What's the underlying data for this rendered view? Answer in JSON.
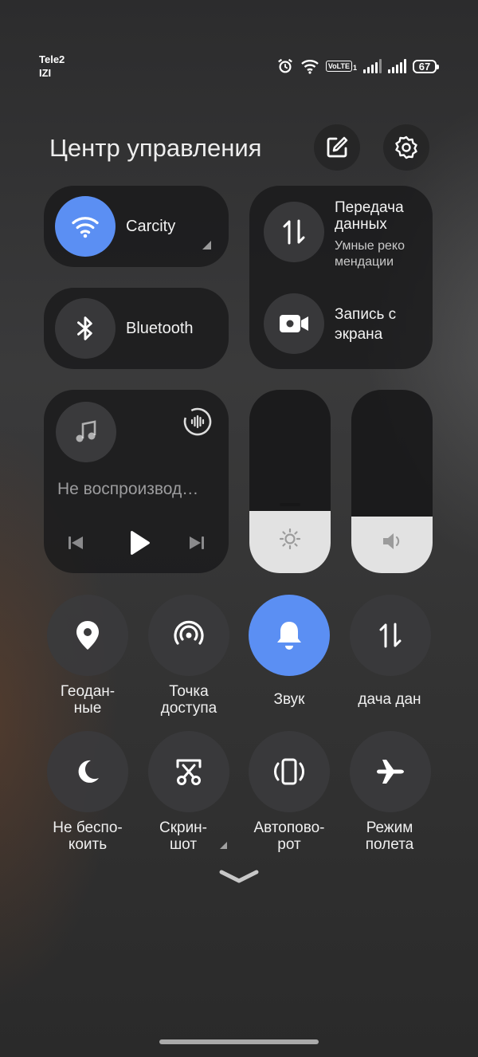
{
  "status_bar": {
    "carrier_1": "Tele2",
    "carrier_2": "IZI",
    "volte": "VoLTE",
    "volte_sim": "1",
    "battery": "67",
    "icons": [
      "alarm-icon",
      "wifi-icon",
      "volte-icon",
      "signal-icon",
      "signal-icon",
      "battery-icon"
    ]
  },
  "header": {
    "title": "Центр управления",
    "edit_icon": "edit-icon",
    "settings_icon": "gear-icon"
  },
  "tiles": {
    "wifi": {
      "label": "Carcity",
      "active": true,
      "icon": "wifi-icon"
    },
    "bluetooth": {
      "label": "Bluetooth",
      "active": false,
      "icon": "bluetooth-icon"
    },
    "data_transfer": {
      "title": "Передача данных",
      "subtitle": "Умные реко мендации",
      "icon": "data-transfer-icon"
    },
    "screen_record": {
      "title": "Запись с экрана",
      "icon": "video-camera-icon"
    }
  },
  "media": {
    "status": "Не воспроизвод…",
    "icons": [
      "music-note-icon",
      "audio-output-icon",
      "previous-icon",
      "play-icon",
      "next-icon"
    ]
  },
  "sliders": {
    "brightness": {
      "level_percent": 34,
      "icon": "sun-icon"
    },
    "volume": {
      "level_percent": 31,
      "icon": "speaker-icon"
    }
  },
  "quick_toggles": [
    {
      "id": "location",
      "label": "Геодан-\nные",
      "icon": "location-pin-icon",
      "active": false
    },
    {
      "id": "hotspot",
      "label": "Точка\nдоступа",
      "icon": "hotspot-icon",
      "active": false
    },
    {
      "id": "sound",
      "label": "Звук",
      "icon": "bell-icon",
      "active": true
    },
    {
      "id": "mobile-data",
      "label": "дача дан",
      "icon": "data-transfer-icon",
      "active": false
    },
    {
      "id": "dnd",
      "label": "Не беспо-\nкоить",
      "icon": "moon-icon",
      "active": false
    },
    {
      "id": "screenshot",
      "label": "Скрин-\nшот",
      "icon": "scissors-icon",
      "active": false
    },
    {
      "id": "autorotate",
      "label": "Автопово-\nрот",
      "icon": "rotate-phone-icon",
      "active": false
    },
    {
      "id": "airplane",
      "label": "Режим\nполета",
      "icon": "airplane-icon",
      "active": false
    }
  ],
  "colors": {
    "accent": "#5b8ff3",
    "tile_bg": "#18181a",
    "slider_fill": "#e2e2e2"
  }
}
